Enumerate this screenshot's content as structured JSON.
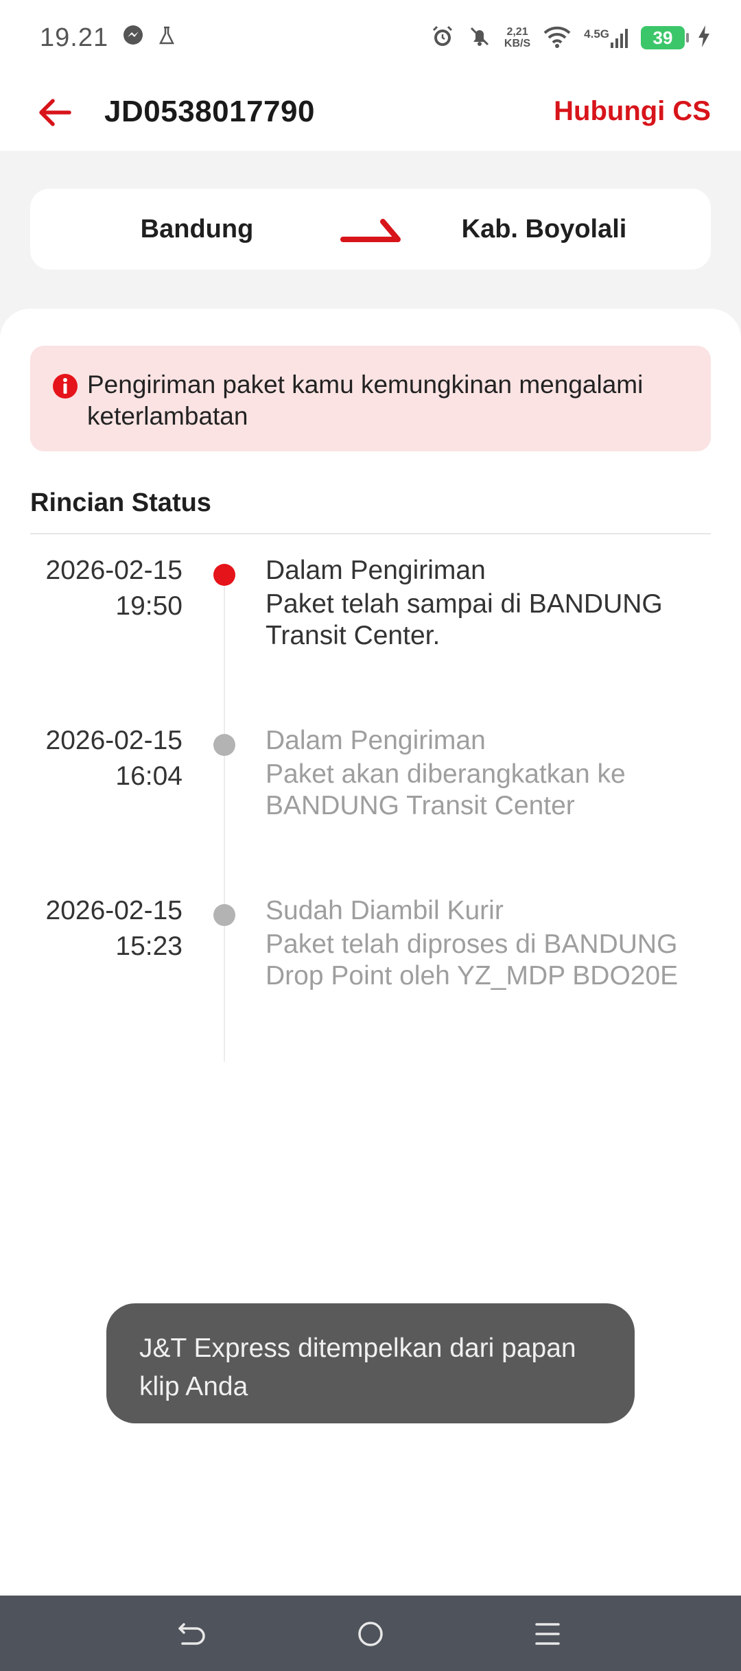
{
  "status_bar": {
    "time": "19.21",
    "net_speed_value": "2,21",
    "net_speed_unit": "KB/S",
    "network_type": "4.5G",
    "battery": "39"
  },
  "header": {
    "title": "JD0538017790",
    "cs_label": "Hubungi CS"
  },
  "route": {
    "from": "Bandung",
    "to": "Kab. Boyolali"
  },
  "warning": {
    "text": "Pengiriman paket kamu kemungkinan mengalami keterlambatan"
  },
  "section": {
    "title": "Rincian Status"
  },
  "events": [
    {
      "date": "2026-02-15",
      "time": "19:50",
      "status": "Dalam Pengiriman",
      "description": "Paket telah sampai di BANDUNG Transit Center."
    },
    {
      "date": "2026-02-15",
      "time": "16:04",
      "status": "Dalam Pengiriman",
      "description": "Paket akan diberangkatkan ke BANDUNG Transit Center"
    },
    {
      "date": "2026-02-15",
      "time": "15:23",
      "status": "Sudah Diambil Kurir",
      "description": "Paket telah diproses di BANDUNG Drop Point oleh YZ_MDP BDO20E"
    }
  ],
  "toast": {
    "text": "J&T Express ditempelkan dari papan klip Anda"
  },
  "colors": {
    "brand_red": "#d7141a",
    "warning_bg": "#fbe3e3",
    "battery_green": "#3cc66a",
    "nav_bar": "#4f535b"
  }
}
